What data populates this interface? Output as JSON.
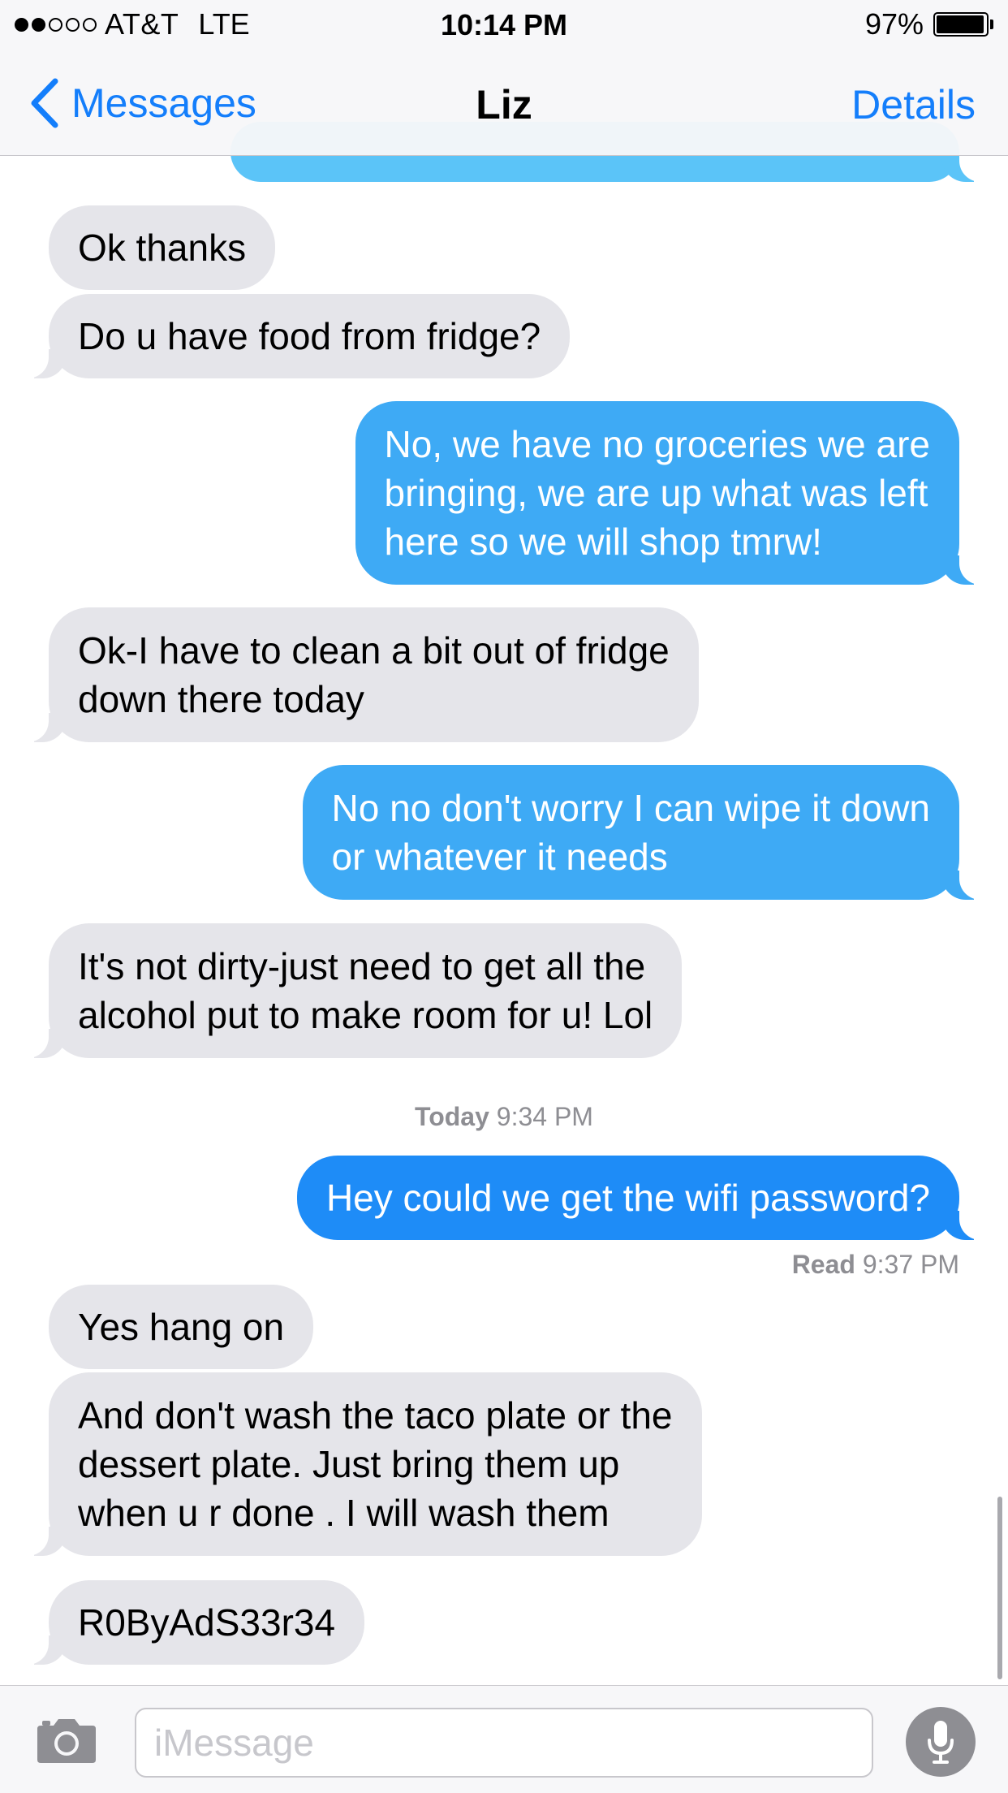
{
  "status_bar": {
    "carrier": "AT&T",
    "network": "LTE",
    "time": "10:14 PM",
    "battery_percent": "97%",
    "battery_level": 0.97,
    "signal_bars_filled": 2,
    "signal_bars_total": 5
  },
  "nav": {
    "back_label": "Messages",
    "title": "Liz",
    "details_label": "Details"
  },
  "messages": [
    {
      "from": "me",
      "text": "",
      "note": "partially scrolled off"
    },
    {
      "from": "them",
      "lines": [
        "Ok thanks"
      ]
    },
    {
      "from": "them",
      "lines": [
        "Do u have food from fridge?"
      ]
    },
    {
      "from": "me",
      "lines": [
        "No, we have no groceries we are",
        "bringing, we are up what was left",
        "here so we will shop tmrw!"
      ]
    },
    {
      "from": "them",
      "lines": [
        "Ok-I have to clean a bit out of fridge",
        "down there today"
      ]
    },
    {
      "from": "me",
      "lines": [
        "No no don't worry I can wipe it down",
        "or whatever it needs"
      ]
    },
    {
      "from": "them",
      "lines": [
        "It's not dirty-just need to get all the",
        "alcohol put to make room for u! Lol"
      ]
    },
    {
      "from": "me",
      "lines": [
        "Hey could we get the wifi password?"
      ]
    },
    {
      "from": "them",
      "lines": [
        "Yes hang on"
      ]
    },
    {
      "from": "them",
      "lines": [
        "And don't wash the taco plate or the",
        "dessert plate. Just bring them up",
        "when u r done . I will wash them"
      ]
    },
    {
      "from": "them",
      "lines": [
        "R0ByAdS33r34"
      ]
    }
  ],
  "timestamp": {
    "day": "Today",
    "time": "9:34 PM"
  },
  "read_receipt": {
    "label": "Read",
    "time": "9:37 PM"
  },
  "input": {
    "placeholder": "iMessage",
    "value": ""
  },
  "icons": {
    "back": "chevron-left-icon",
    "camera": "camera-icon",
    "mic": "microphone-icon"
  },
  "colors": {
    "accent": "#147efb",
    "incoming_bubble": "#e5e5ea",
    "outgoing_bubble": "#3eaaf5",
    "outgoing_bubble_dark": "#1e8cf7",
    "meta_text": "#8e8e93"
  }
}
